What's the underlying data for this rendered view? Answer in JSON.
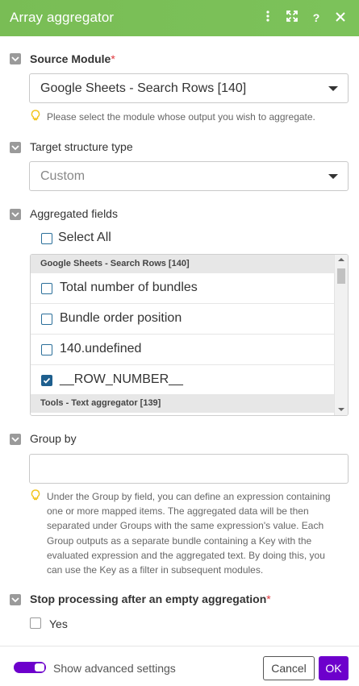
{
  "header": {
    "title": "Array aggregator",
    "icons": [
      "more-vertical-icon",
      "expand-icon",
      "help-icon",
      "close-icon"
    ],
    "background": "#79bd55"
  },
  "source_module": {
    "label": "Source Module",
    "required_mark": "*",
    "value": "Google Sheets - Search Rows [140]",
    "hint": "Please select the module whose output you wish to aggregate."
  },
  "target_structure": {
    "label": "Target structure type",
    "value": "Custom"
  },
  "aggregated_fields": {
    "label": "Aggregated fields",
    "select_all_label": "Select All",
    "select_all_checked": false,
    "groups": [
      {
        "header": "Google Sheets - Search Rows [140]",
        "items": [
          {
            "label": "Total number of bundles",
            "checked": false
          },
          {
            "label": "Bundle order position",
            "checked": false
          },
          {
            "label": "140.undefined",
            "checked": false
          },
          {
            "label": "__ROW_NUMBER__",
            "checked": true
          }
        ]
      },
      {
        "header": "Tools - Text aggregator [139]",
        "items": []
      }
    ]
  },
  "group_by": {
    "label": "Group by",
    "value": "",
    "hint": "Under the Group by field, you can define an expression containing one or more mapped items. The aggregated data will be then separated under Groups with the same expression's value. Each Group outputs as a separate bundle containing a Key with the evaluated expression and the aggregated text. By doing this, you can use the Key as a filter in subsequent modules."
  },
  "stop_processing": {
    "label": "Stop processing after an empty aggregation",
    "required_mark": "*",
    "option_label": "Yes",
    "checked": false
  },
  "footer": {
    "advanced_label": "Show advanced settings",
    "advanced_on": true,
    "cancel_label": "Cancel",
    "ok_label": "OK",
    "accent": "#6d00cc"
  }
}
